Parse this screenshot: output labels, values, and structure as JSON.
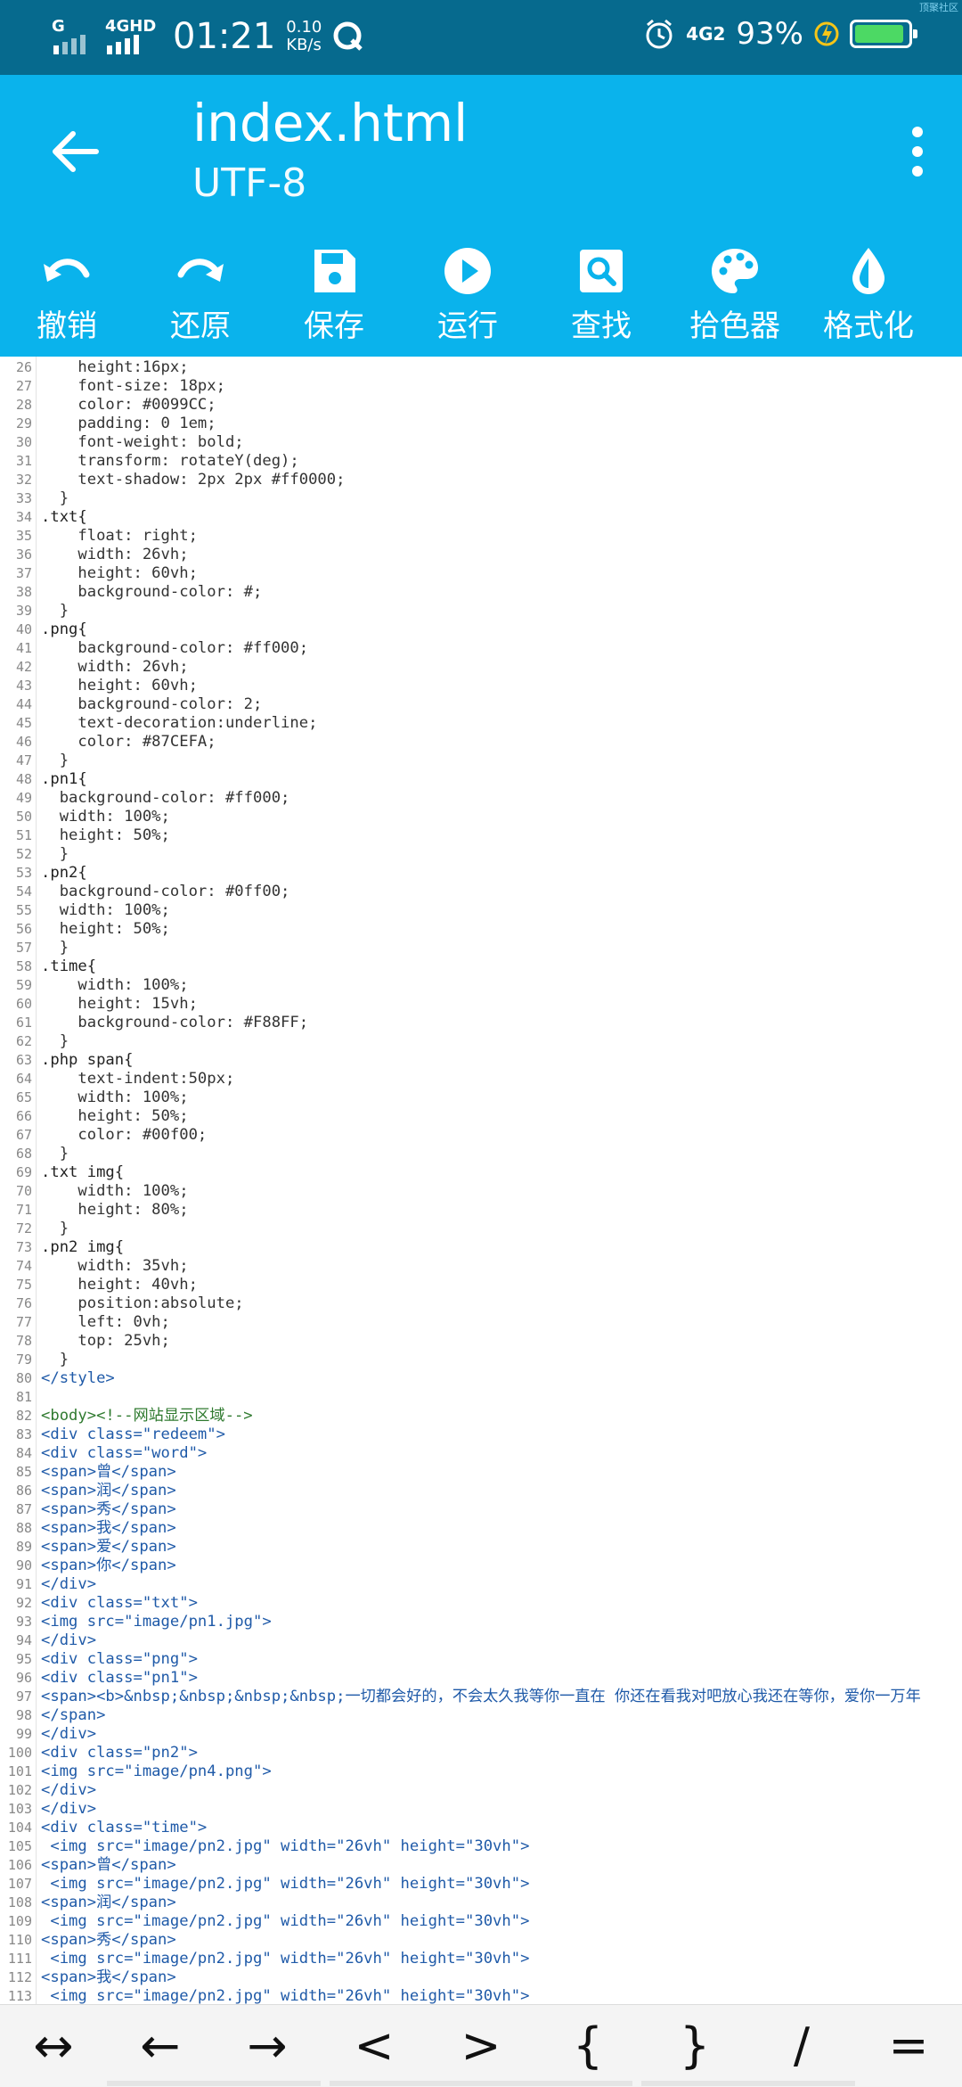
{
  "status": {
    "signal1": "G",
    "signal2": "4GHD",
    "time": "01:21",
    "speed_value": "0.10",
    "speed_unit": "KB/s",
    "network": "4G2",
    "battery": "93%",
    "battery_level": 0.93,
    "corner_tag": "顶聚社区"
  },
  "appbar": {
    "title": "index.html",
    "subtitle": "UTF-8"
  },
  "toolbar": {
    "items": [
      {
        "label": "撤销",
        "icon": "undo-icon"
      },
      {
        "label": "还原",
        "icon": "redo-icon"
      },
      {
        "label": "保存",
        "icon": "save-icon"
      },
      {
        "label": "运行",
        "icon": "run-icon"
      },
      {
        "label": "查找",
        "icon": "search-icon"
      },
      {
        "label": "拾色器",
        "icon": "palette-icon"
      },
      {
        "label": "格式化",
        "icon": "format-icon"
      }
    ]
  },
  "editor": {
    "lines": [
      {
        "n": "26",
        "code": "    height:16px;"
      },
      {
        "n": "27",
        "code": "    font-size: 18px;"
      },
      {
        "n": "28",
        "code": "    color: #0099CC;"
      },
      {
        "n": "29",
        "code": "    padding: 0 1em;"
      },
      {
        "n": "30",
        "code": "    font-weight: bold;"
      },
      {
        "n": "31",
        "code": "    transform: rotateY(deg);"
      },
      {
        "n": "32",
        "code": "    text-shadow: 2px 2px #ff0000;"
      },
      {
        "n": "33",
        "code": "  }"
      },
      {
        "n": "34",
        "code": ".txt{"
      },
      {
        "n": "35",
        "code": "    float: right;"
      },
      {
        "n": "36",
        "code": "    width: 26vh;"
      },
      {
        "n": "37",
        "code": "    height: 60vh;"
      },
      {
        "n": "38",
        "code": "    background-color: #;"
      },
      {
        "n": "39",
        "code": "  }"
      },
      {
        "n": "40",
        "code": ".png{"
      },
      {
        "n": "41",
        "code": "    background-color: #ff000;"
      },
      {
        "n": "42",
        "code": "    width: 26vh;"
      },
      {
        "n": "43",
        "code": "    height: 60vh;"
      },
      {
        "n": "44",
        "code": "    background-color: 2;"
      },
      {
        "n": "45",
        "code": "    text-decoration:underline;"
      },
      {
        "n": "46",
        "code": "    color: #87CEFA;"
      },
      {
        "n": "47",
        "code": "  }"
      },
      {
        "n": "48",
        "code": ".pn1{"
      },
      {
        "n": "49",
        "code": "  background-color: #ff000;"
      },
      {
        "n": "50",
        "code": "  width: 100%;"
      },
      {
        "n": "51",
        "code": "  height: 50%;"
      },
      {
        "n": "52",
        "code": "  }"
      },
      {
        "n": "53",
        "code": ".pn2{"
      },
      {
        "n": "54",
        "code": "  background-color: #0ff00;"
      },
      {
        "n": "55",
        "code": "  width: 100%;"
      },
      {
        "n": "56",
        "code": "  height: 50%;"
      },
      {
        "n": "57",
        "code": "  }"
      },
      {
        "n": "58",
        "code": ".time{"
      },
      {
        "n": "59",
        "code": "    width: 100%;"
      },
      {
        "n": "60",
        "code": "    height: 15vh;"
      },
      {
        "n": "61",
        "code": "    background-color: #F88FF;"
      },
      {
        "n": "62",
        "code": "  }"
      },
      {
        "n": "63",
        "code": ".php span{"
      },
      {
        "n": "64",
        "code": "    text-indent:50px;"
      },
      {
        "n": "65",
        "code": "    width: 100%;"
      },
      {
        "n": "66",
        "code": "    height: 50%;"
      },
      {
        "n": "67",
        "code": "    color: #00f00;"
      },
      {
        "n": "68",
        "code": "  }"
      },
      {
        "n": "69",
        "code": ".txt img{"
      },
      {
        "n": "70",
        "code": "    width: 100%;"
      },
      {
        "n": "71",
        "code": "    height: 80%;"
      },
      {
        "n": "72",
        "code": "  }"
      },
      {
        "n": "73",
        "code": ".pn2 img{"
      },
      {
        "n": "74",
        "code": "    width: 35vh;"
      },
      {
        "n": "75",
        "code": "    height: 40vh;"
      },
      {
        "n": "76",
        "code": "    position:absolute;"
      },
      {
        "n": "77",
        "code": "    left: 0vh;"
      },
      {
        "n": "78",
        "code": "    top: 25vh;"
      },
      {
        "n": "79",
        "code": "  }"
      },
      {
        "n": "80",
        "code": "</style>"
      },
      {
        "n": "81",
        "code": ""
      },
      {
        "n": "82",
        "code": "<body><!--网站显示区域-->"
      },
      {
        "n": "83",
        "code": "<div class=\"redeem\">"
      },
      {
        "n": "84",
        "code": "<div class=\"word\">"
      },
      {
        "n": "85",
        "code": "<span>曾</span>"
      },
      {
        "n": "86",
        "code": "<span>润</span>"
      },
      {
        "n": "87",
        "code": "<span>秀</span>"
      },
      {
        "n": "88",
        "code": "<span>我</span>"
      },
      {
        "n": "89",
        "code": "<span>爱</span>"
      },
      {
        "n": "90",
        "code": "<span>你</span>"
      },
      {
        "n": "91",
        "code": "</div>"
      },
      {
        "n": "92",
        "code": "<div class=\"txt\">"
      },
      {
        "n": "93",
        "code": "<img src=\"image/pn1.jpg\">"
      },
      {
        "n": "94",
        "code": "</div>"
      },
      {
        "n": "95",
        "code": "<div class=\"png\">"
      },
      {
        "n": "96",
        "code": "<div class=\"pn1\">"
      },
      {
        "n": "97",
        "code": "<span><b>&nbsp;&nbsp;&nbsp;&nbsp;一切都会好的，不会太久我等你一直在 你还在看我对吧放心我还在等你，爱你一万年"
      },
      {
        "n": "98",
        "code": "</span>"
      },
      {
        "n": "99",
        "code": "</div>"
      },
      {
        "n": "100",
        "code": "<div class=\"pn2\">"
      },
      {
        "n": "101",
        "code": "<img src=\"image/pn4.png\">"
      },
      {
        "n": "102",
        "code": "</div>"
      },
      {
        "n": "103",
        "code": "</div>"
      },
      {
        "n": "104",
        "code": "<div class=\"time\">"
      },
      {
        "n": "105",
        "code": " <img src=\"image/pn2.jpg\" width=\"26vh\" height=\"30vh\">"
      },
      {
        "n": "106",
        "code": "<span>曾</span>"
      },
      {
        "n": "107",
        "code": " <img src=\"image/pn2.jpg\" width=\"26vh\" height=\"30vh\">"
      },
      {
        "n": "108",
        "code": "<span>润</span>"
      },
      {
        "n": "109",
        "code": " <img src=\"image/pn2.jpg\" width=\"26vh\" height=\"30vh\">"
      },
      {
        "n": "110",
        "code": "<span>秀</span>"
      },
      {
        "n": "111",
        "code": " <img src=\"image/pn2.jpg\" width=\"26vh\" height=\"30vh\">"
      },
      {
        "n": "112",
        "code": "<span>我</span>"
      },
      {
        "n": "113",
        "code": " <img src=\"image/pn2.jpg\" width=\"26vh\" height=\"30vh\">"
      }
    ]
  },
  "keys": [
    "↔",
    "←",
    "→",
    "<",
    ">",
    "{",
    "}",
    "/",
    "="
  ]
}
